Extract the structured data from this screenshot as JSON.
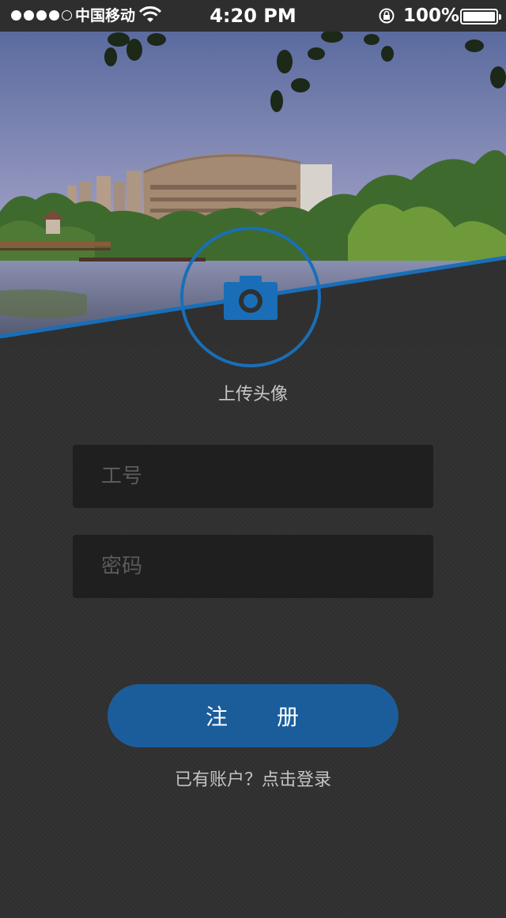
{
  "status_bar": {
    "carrier": "中国移动",
    "time": "4:20 PM",
    "battery_percent": "100%",
    "battery_level": 1.0,
    "signal_bars_filled": 4,
    "signal_bars_total": 5
  },
  "hero": {
    "image": "campus-building-lake-photo"
  },
  "avatar": {
    "icon": "camera-icon",
    "label": "上传头像"
  },
  "form": {
    "employee_id": {
      "placeholder": "工号",
      "value": ""
    },
    "password": {
      "placeholder": "密码",
      "value": ""
    }
  },
  "register_button": {
    "label": "注　　册"
  },
  "login_link": {
    "label": "已有账户？点击登录"
  },
  "colors": {
    "accent": "#1a6eb8",
    "button": "#1b5d9b",
    "background": "#303030",
    "input_bg": "#1f1f1f"
  }
}
